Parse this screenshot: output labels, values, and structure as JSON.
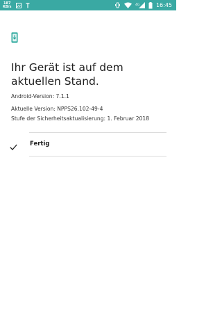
{
  "status_bar": {
    "net_speed_value": "187",
    "net_speed_unit": "KB/s",
    "network_label": "4G",
    "time": "16:45"
  },
  "update": {
    "title": "Ihr Gerät ist auf dem aktuellen Stand.",
    "android_version": "Android-Version: 7.1.1",
    "current_version": "Aktuelle Version: NPPS26.102-49-4",
    "security_patch": "Stufe der Sicherheitsaktualisierung: 1. Februar 2018"
  },
  "action": {
    "done_label": "Fertig"
  },
  "colors": {
    "status_bar": "#3aa9a3",
    "accent": "#26a69a"
  },
  "icons": [
    "gallery-icon",
    "notification-t-icon",
    "vibrate-icon",
    "wifi-icon",
    "signal-icon",
    "battery-icon",
    "system-update-icon",
    "check-icon"
  ]
}
